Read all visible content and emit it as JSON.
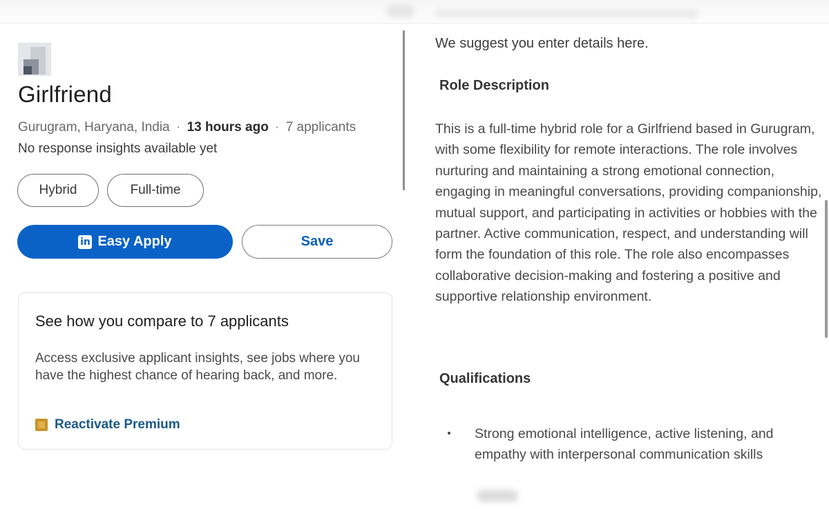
{
  "job": {
    "title": "Girlfriend",
    "location": "Gurugram, Haryana, India",
    "posted": "13 hours ago",
    "applicants": "7 applicants",
    "separator": "·",
    "insights": "No response insights available yet",
    "chips": [
      "Hybrid",
      "Full-time"
    ]
  },
  "actions": {
    "easy_apply_icon": "in",
    "easy_apply_label": "Easy Apply",
    "save_label": "Save"
  },
  "compare_card": {
    "title": "See how you compare to 7 applicants",
    "body": "Access exclusive applicant insights, see jobs where you have the highest chance of hearing back, and more.",
    "link_label": "Reactivate Premium",
    "link_icon": "premium-icon"
  },
  "description": {
    "suggest": "We suggest you enter details here.",
    "role_heading": "Role Description",
    "role_text": "This is a full-time hybrid role for a Girlfriend based in Gurugram, with some flexibility for remote interactions. The role involves nurturing and maintaining a strong emotional connection, engaging in meaningful conversations, providing companionship, mutual support, and participating in activities or hobbies with the partner. Active communication, respect, and understanding will form the foundation of this role. The role also encompasses collaborative decision-making and fostering a positive and supportive relationship environment.",
    "qual_heading": "Qualifications",
    "qualifications": [
      "Strong emotional intelligence, active listening, and empathy with interpersonal communication skills"
    ]
  },
  "colors": {
    "primary_button": "#0b62c6",
    "link": "#1a5a8a",
    "premium_icon": "#c9922b"
  }
}
